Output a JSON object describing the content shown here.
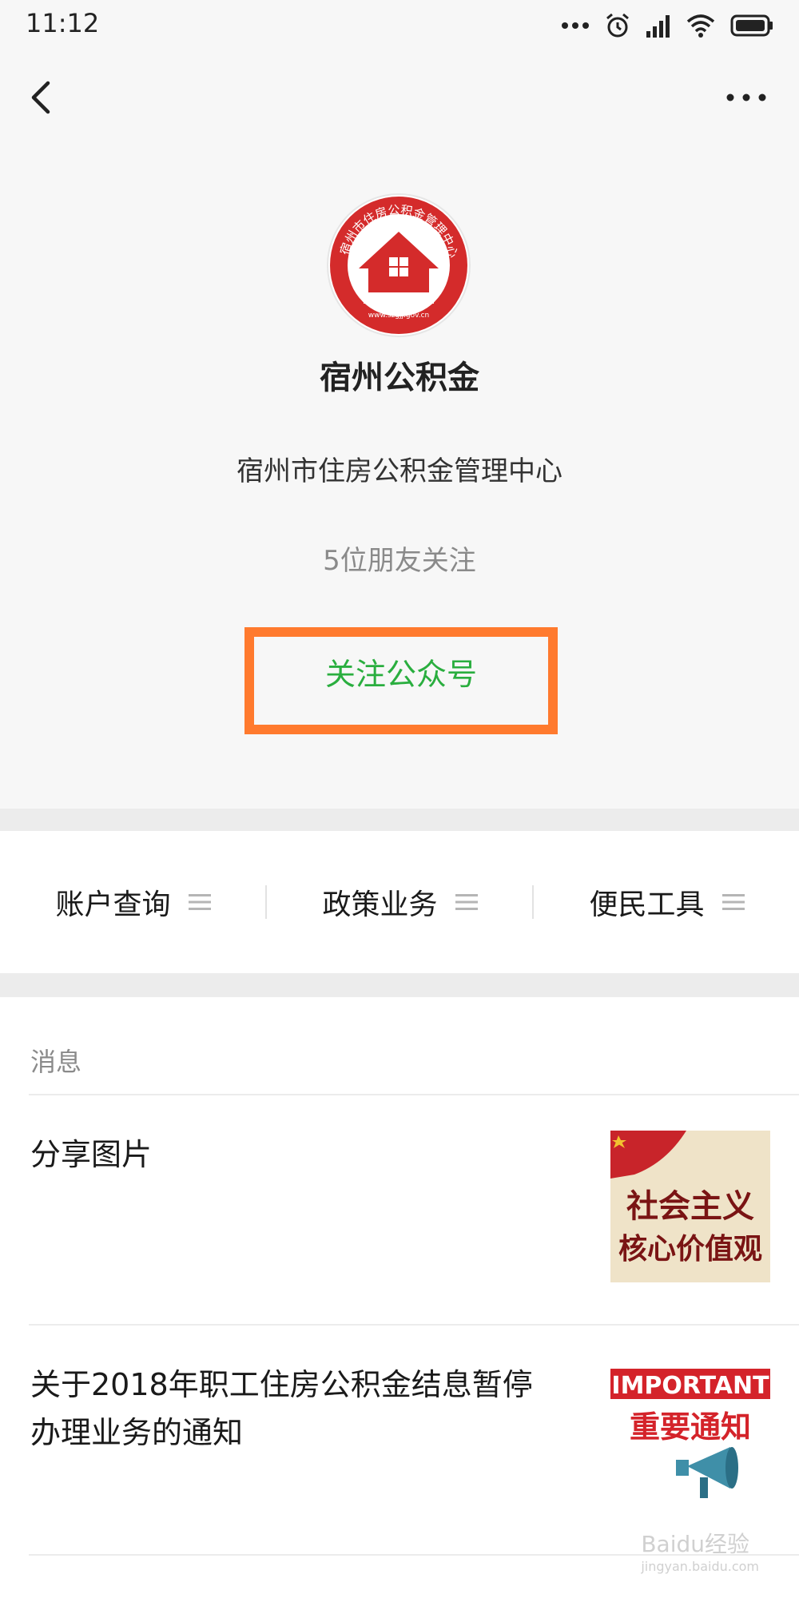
{
  "status_bar": {
    "time": "11:12",
    "icons": [
      "dots-icon",
      "alarm-icon",
      "signal-icon",
      "wifi-icon",
      "battery-icon"
    ]
  },
  "nav": {
    "back_icon": "chevron-left-icon",
    "more_icon": "more-horizontal-icon"
  },
  "profile": {
    "avatar_text": "宿州市住房公积金管理中心",
    "avatar_url_text": "www.szgjj.gov.cn",
    "name": "宿州公积金",
    "description": "宿州市住房公积金管理中心",
    "friends_following": "5位朋友关注",
    "follow_button": "关注公众号",
    "colors": {
      "follow_text": "#2aae3f",
      "highlight_border": "#ff7a2e",
      "logo_red": "#d42b2b"
    }
  },
  "menu": {
    "items": [
      {
        "label": "账户查询",
        "icon": "hamburger-icon"
      },
      {
        "label": "政策业务",
        "icon": "hamburger-icon"
      },
      {
        "label": "便民工具",
        "icon": "hamburger-icon"
      }
    ]
  },
  "messages": {
    "section_title": "消息",
    "items": [
      {
        "title": "分享图片",
        "thumb_text_line1": "社会主义",
        "thumb_text_line2": "核心价值观"
      },
      {
        "title": "关于2018年职工住房公积金结息暂停办理业务的通知",
        "thumb_text_line1": "IMPORTANT",
        "thumb_text_line2": "重要通知"
      }
    ]
  },
  "watermark": {
    "brand": "Baidu经验",
    "url": "jingyan.baidu.com"
  }
}
